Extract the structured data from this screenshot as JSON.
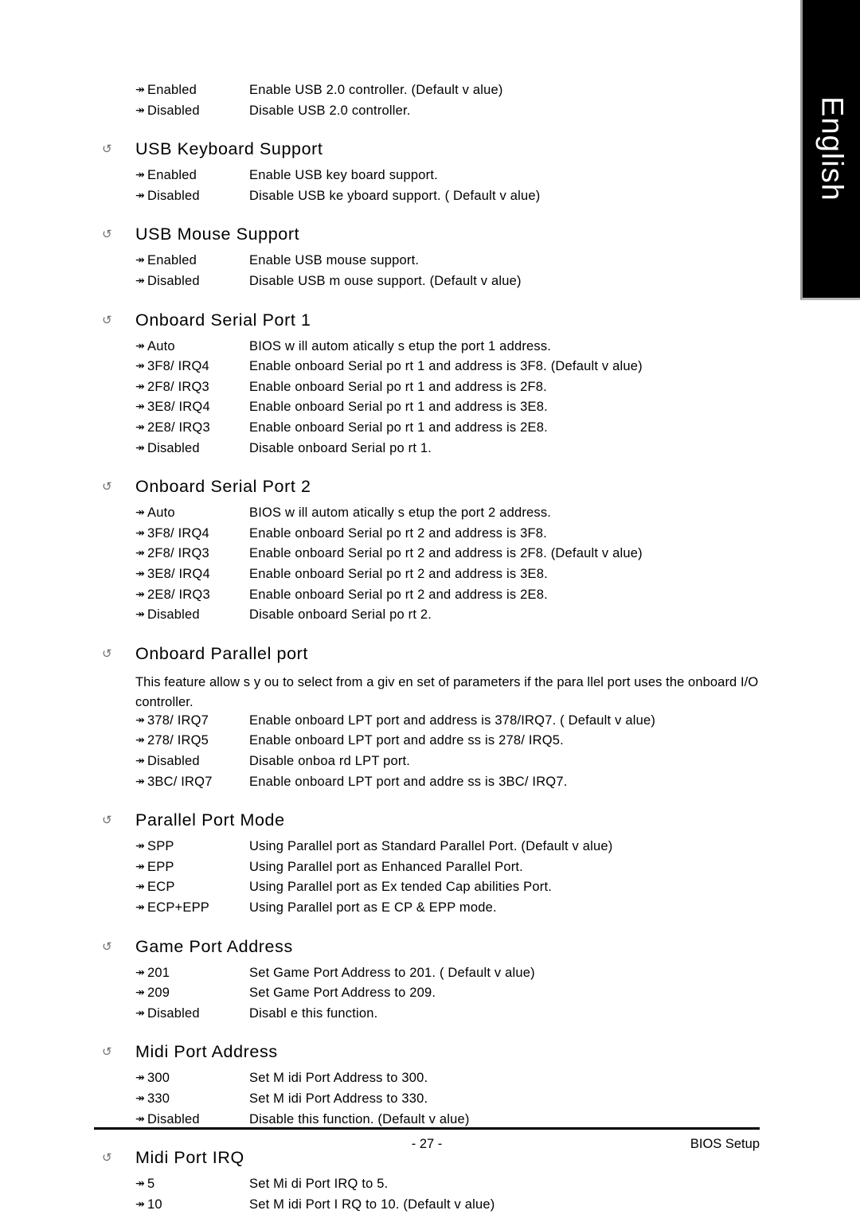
{
  "document": {
    "type": "bios-manual-page",
    "language_tab": "English",
    "footer": {
      "page_number": "- 27 -",
      "right_label": "BIOS Setup"
    }
  },
  "icons": {
    "heading_bullet": "spiral-arrow-icon",
    "option_bullet": "double-arrow-icon",
    "heading_bullet_glyph": "↺",
    "option_bullet_glyph": "↠"
  },
  "top_options": [
    {
      "label": "Enabled",
      "desc": "Enable USB 2.0 controller. (Default v alue)"
    },
    {
      "label": "Disabled",
      "desc": "Disable USB 2.0 controller."
    }
  ],
  "sections": [
    {
      "title": "USB Keyboard Support",
      "paragraph": null,
      "options": [
        {
          "label": "Enabled",
          "desc": "Enable USB key board support."
        },
        {
          "label": "Disabled",
          "desc": "Disable USB ke yboard support. ( Default v alue)"
        }
      ]
    },
    {
      "title": "USB Mouse Support",
      "paragraph": null,
      "options": [
        {
          "label": "Enabled",
          "desc": "Enable USB mouse support."
        },
        {
          "label": "Disabled",
          "desc": "Disable USB m ouse support. (Default v alue)"
        }
      ]
    },
    {
      "title": "Onboard Serial Port 1",
      "paragraph": null,
      "options": [
        {
          "label": "Auto",
          "desc": "BIOS w ill autom atically s etup the port 1 address."
        },
        {
          "label": "3F8/ IRQ4",
          "desc": "Enable onboard Serial po rt 1 and address  is 3F8. (Default v alue)"
        },
        {
          "label": "2F8/ IRQ3",
          "desc": "Enable onboard Serial po rt 1 and address  is 2F8."
        },
        {
          "label": "3E8/ IRQ4",
          "desc": "Enable onboard Serial po rt 1 and address  is 3E8."
        },
        {
          "label": "2E8/ IRQ3",
          "desc": "Enable onboard Serial po rt 1 and address  is 2E8."
        },
        {
          "label": "Disabled",
          "desc": "Disable onboard Serial po rt 1."
        }
      ]
    },
    {
      "title": "Onboard Serial Port 2",
      "paragraph": null,
      "options": [
        {
          "label": "Auto",
          "desc": "BIOS w ill autom atically s etup the port 2 address."
        },
        {
          "label": "3F8/ IRQ4",
          "desc": "Enable onboard Serial po rt 2 and address  is 3F8."
        },
        {
          "label": "2F8/ IRQ3",
          "desc": "Enable onboard Serial po rt 2 and address  is 2F8. (Default v alue)"
        },
        {
          "label": "3E8/ IRQ4",
          "desc": "Enable onboard Serial po rt 2 and address  is 3E8."
        },
        {
          "label": "2E8/ IRQ3",
          "desc": "Enable onboard Serial po rt 2 and address  is 2E8."
        },
        {
          "label": "Disabled",
          "desc": "Disable onboard Serial po rt 2."
        }
      ]
    },
    {
      "title": "Onboard Parallel port",
      "paragraph": "This feature allow s y ou to select from a giv en set of parameters if the para llel port uses the onboard I/O controller.",
      "options": [
        {
          "label": "378/ IRQ7",
          "desc": "Enable onboard LPT port and address is 378/IRQ7. ( Default v alue)"
        },
        {
          "label": "278/ IRQ5",
          "desc": "Enable onboard LPT port and addre ss is 278/ IRQ5."
        },
        {
          "label": "Disabled",
          "desc": "Disable onboa rd LPT port."
        },
        {
          "label": "3BC/ IRQ7",
          "desc": "Enable onboard LPT port and addre ss is 3BC/ IRQ7."
        }
      ]
    },
    {
      "title": "Parallel Port Mode",
      "paragraph": null,
      "options": [
        {
          "label": "SPP",
          "desc": "Using Parallel port as Standard Parallel Port. (Default v alue)"
        },
        {
          "label": "EPP",
          "desc": "Using Parallel port as Enhanced Parallel Port."
        },
        {
          "label": "ECP",
          "desc": "Using Parallel port as Ex tended Cap abilities  Port."
        },
        {
          "label": "ECP+EPP",
          "desc": "Using Parallel port as E CP & EPP mode."
        }
      ]
    },
    {
      "title": "Game Port Address",
      "paragraph": null,
      "options": [
        {
          "label": "201",
          "desc": "Set Game Port Address to 201. ( Default v alue)"
        },
        {
          "label": "209",
          "desc": "Set Game Port Address to 209."
        },
        {
          "label": "Disabled",
          "desc": "Disabl e this function."
        }
      ]
    },
    {
      "title": "Midi Port Address",
      "paragraph": null,
      "options": [
        {
          "label": "300",
          "desc": "Set M idi Port Address to 300."
        },
        {
          "label": "330",
          "desc": "Set M idi Port Address to 330."
        },
        {
          "label": "Disabled",
          "desc": "Disable this function. (Default v alue)"
        }
      ]
    },
    {
      "title": "Midi Port IRQ",
      "paragraph": null,
      "options": [
        {
          "label": "5",
          "desc": "Set Mi di Port IRQ  to 5."
        },
        {
          "label": "10",
          "desc": "Set M idi Port I RQ to 10.  (Default v alue)"
        }
      ]
    }
  ]
}
